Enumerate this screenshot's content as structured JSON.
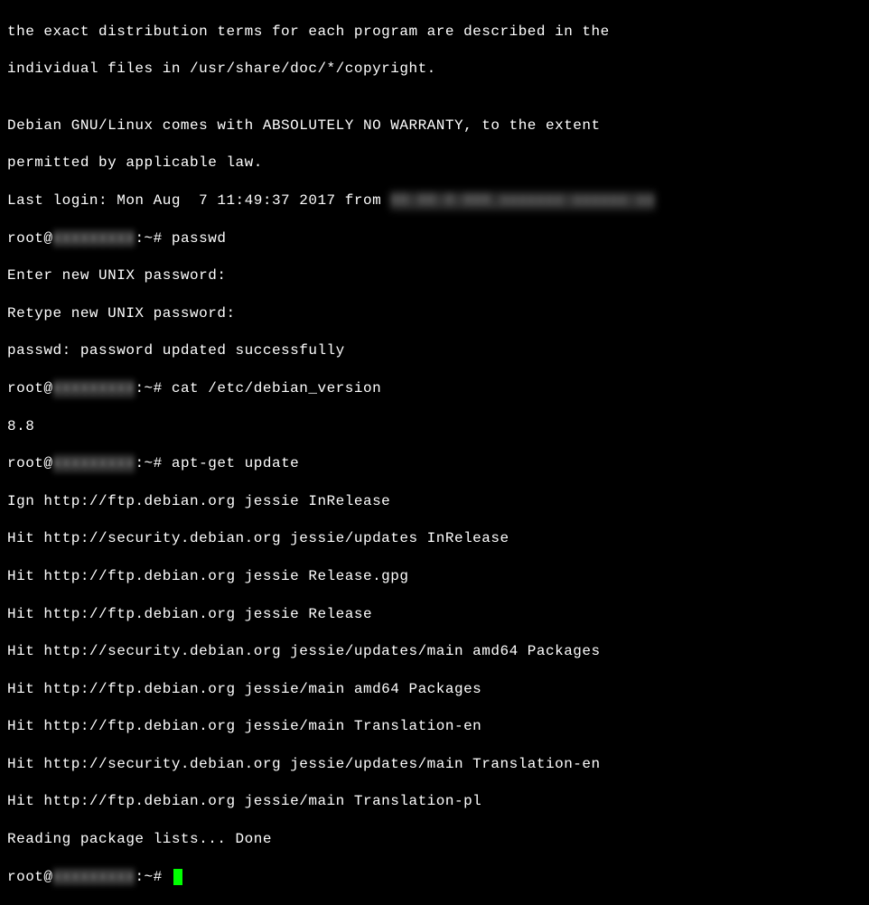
{
  "motd": {
    "line1": "the exact distribution terms for each program are described in the",
    "line2": "individual files in /usr/share/doc/*/copyright.",
    "blank": "",
    "line3": "Debian GNU/Linux comes with ABSOLUTELY NO WARRANTY, to the extent",
    "line4": "permitted by applicable law."
  },
  "lastlogin": {
    "prefix": "Last login: Mon Aug  7 11:49:37 2017 from ",
    "redacted_host": "XX-XX-X-XXX.xxxxxxx-xxxxxx-xx"
  },
  "prompt1": {
    "user": "root@",
    "hostredacted": "xxxxxxxxx",
    "path": ":~# ",
    "cmd": "passwd"
  },
  "passwd": {
    "enter": "Enter new UNIX password:",
    "retype": "Retype new UNIX password:",
    "success": "passwd: password updated successfully"
  },
  "prompt2": {
    "user": "root@",
    "hostredacted": "xxxxxxxxx",
    "path": ":~# ",
    "cmd": "cat /etc/debian_version"
  },
  "debian_version": "8.8",
  "prompt3": {
    "user": "root@",
    "hostredacted": "xxxxxxxxx",
    "path": ":~# ",
    "cmd": "apt-get update"
  },
  "apt": {
    "l1": "Ign http://ftp.debian.org jessie InRelease",
    "l2": "Hit http://security.debian.org jessie/updates InRelease",
    "l3": "Hit http://ftp.debian.org jessie Release.gpg",
    "l4": "Hit http://ftp.debian.org jessie Release",
    "l5": "Hit http://security.debian.org jessie/updates/main amd64 Packages",
    "l6": "Hit http://ftp.debian.org jessie/main amd64 Packages",
    "l7": "Hit http://ftp.debian.org jessie/main Translation-en",
    "l8": "Hit http://security.debian.org jessie/updates/main Translation-en",
    "l9": "Hit http://ftp.debian.org jessie/main Translation-pl",
    "reading": "Reading package lists... Done"
  },
  "prompt4": {
    "user": "root@",
    "hostredacted": "xxxxxxxxx",
    "path": ":~# "
  }
}
